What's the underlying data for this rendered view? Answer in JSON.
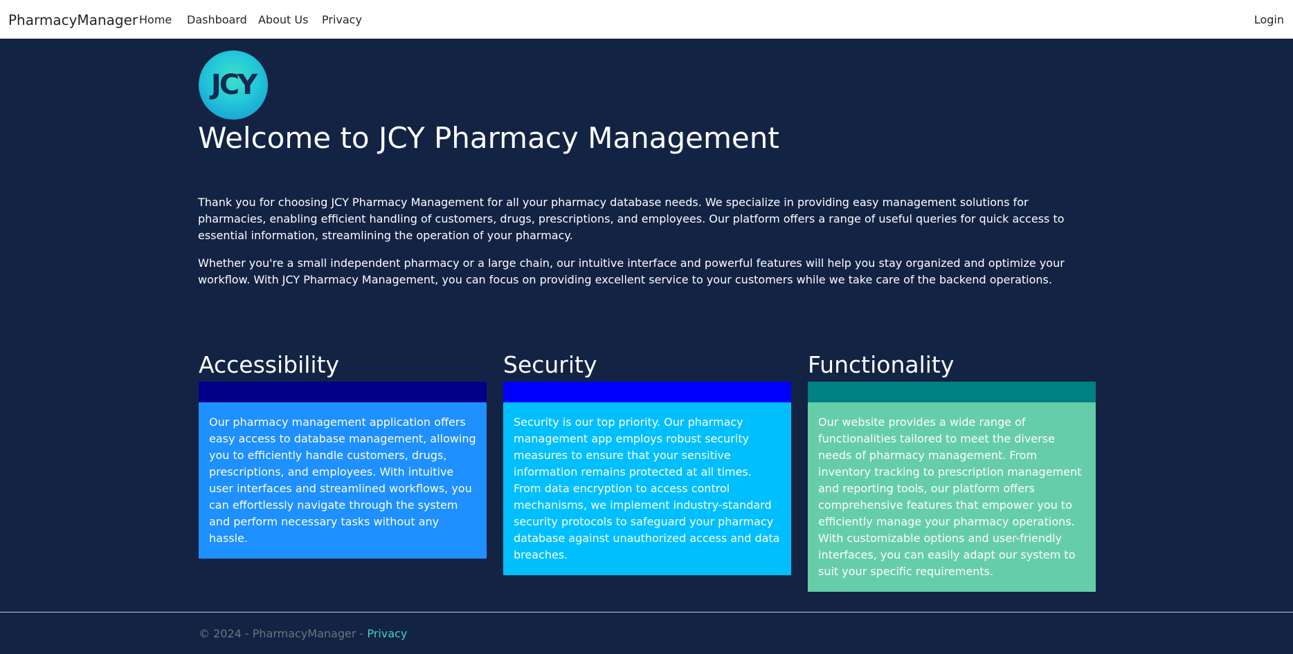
{
  "navbar": {
    "brand": "PharmacyManager",
    "links": [
      {
        "label": "Home"
      },
      {
        "label": "Dashboard"
      },
      {
        "label": "About Us"
      },
      {
        "label": "Privacy"
      }
    ],
    "login_label": "Login"
  },
  "logo": {
    "text": "JCY"
  },
  "main": {
    "title": "Welcome to JCY Pharmacy Management",
    "paragraphs": [
      "Thank you for choosing JCY Pharmacy Management for all your pharmacy database needs. We specialize in providing easy management solutions for pharmacies, enabling efficient handling of customers, drugs, prescriptions, and employees. Our platform offers a range of useful queries for quick access to essential information, streamlining the operation of your pharmacy.",
      "Whether you're a small independent pharmacy or a large chain, our intuitive interface and powerful features will help you stay organized and optimize your workflow. With JCY Pharmacy Management, you can focus on providing excellent service to your customers while we take care of the backend operations."
    ]
  },
  "features": [
    {
      "heading": "Accessibility",
      "body": "Our pharmacy management application offers easy access to database management, allowing you to efficiently handle customers, drugs, prescriptions, and employees. With intuitive user interfaces and streamlined workflows, you can effortlessly navigate through the system and perform necessary tasks without any hassle.",
      "bar_color": "#00008b",
      "body_color": "#1e90ff"
    },
    {
      "heading": "Security",
      "body": "Security is our top priority. Our pharmacy management app employs robust security measures to ensure that your sensitive information remains protected at all times. From data encryption to access control mechanisms, we implement industry-standard security protocols to safeguard your pharmacy database against unauthorized access and data breaches.",
      "bar_color": "#0000ff",
      "body_color": "#00bfff"
    },
    {
      "heading": "Functionality",
      "body": "Our website provides a wide range of functionalities tailored to meet the diverse needs of pharmacy management. From inventory tracking to prescription management and reporting tools, our platform offers comprehensive features that empower you to efficiently manage your pharmacy operations. With customizable options and user-friendly interfaces, you can easily adapt our system to suit your specific requirements.",
      "bar_color": "#008080",
      "body_color": "#66cdaa"
    }
  ],
  "footer": {
    "copyright": "© 2024 - PharmacyManager - ",
    "privacy_label": "Privacy"
  },
  "colors": {
    "background": "#132344",
    "footer_link": "#3ad2c8"
  }
}
